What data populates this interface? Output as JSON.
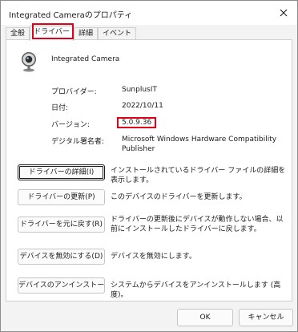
{
  "window": {
    "title": "Integrated Cameraのプロパティ"
  },
  "tabs": [
    {
      "label": "全般"
    },
    {
      "label": "ドライバー"
    },
    {
      "label": "詳細"
    },
    {
      "label": "イベント"
    }
  ],
  "device": {
    "name": "Integrated Camera",
    "icon": "webcam-icon"
  },
  "properties": [
    {
      "label": "プロバイダー:",
      "value": "SunplusIT"
    },
    {
      "label": "日付:",
      "value": "2022/10/11"
    },
    {
      "label": "バージョン:",
      "value": "5.0.9.36"
    },
    {
      "label": "デジタル署名者:",
      "value_line1": "Microsoft Windows Hardware Compatibility",
      "value_line2": "Publisher"
    }
  ],
  "actions": [
    {
      "label": "ドライバーの詳細(I)",
      "desc": "インストールされているドライバー ファイルの詳細を表示します。"
    },
    {
      "label": "ドライバーの更新(P)",
      "desc": "このデバイスのドライバーを更新します。"
    },
    {
      "label": "ドライバーを元に戻す(R)",
      "desc": "ドライバーの更新後にデバイスが動作しない場合、以前にインストールしたドライバーに戻します。"
    },
    {
      "label": "デバイスを無効にする(D)",
      "desc": "デバイスを無効にします。"
    },
    {
      "label": "デバイスのアンインストール(U)",
      "desc": "システムからデバイスをアンインストールします (高度)。"
    }
  ],
  "footer": {
    "ok_label": "OK",
    "cancel_label": "キャンセル"
  },
  "highlight_color": "#e0001a"
}
